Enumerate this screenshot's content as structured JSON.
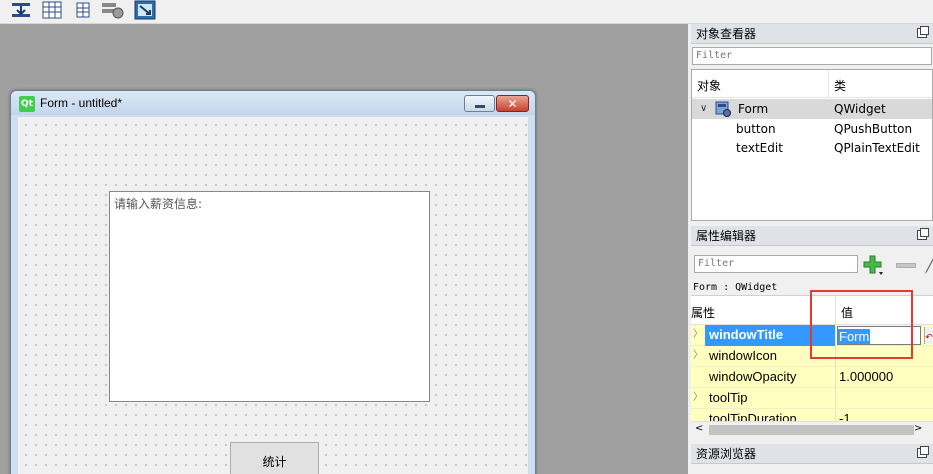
{
  "toolbar": {
    "buttons": [
      {
        "name": "layout-form-icon"
      },
      {
        "name": "layout-grid-icon"
      },
      {
        "name": "layout-grid-small-icon"
      },
      {
        "name": "break-layout-icon"
      },
      {
        "name": "adjust-size-icon"
      }
    ]
  },
  "form_window": {
    "title": "Form - untitled*",
    "logo_text": "Qt",
    "close_glyph": "✕",
    "text_edit": {
      "text": "请输入薪资信息:"
    },
    "push_button": {
      "label": "统计"
    }
  },
  "object_inspector": {
    "title": "对象查看器",
    "filter_placeholder": "Filter",
    "columns": {
      "object": "对象",
      "class": "类"
    },
    "rows": [
      {
        "name": "Form",
        "class": "QWidget",
        "selected": true
      },
      {
        "name": "button",
        "class": "QPushButton",
        "selected": false
      },
      {
        "name": "textEdit",
        "class": "QPlainTextEdit",
        "selected": false
      }
    ]
  },
  "property_editor": {
    "title": "属性编辑器",
    "filter_placeholder": "Filter",
    "class_line": "Form : QWidget",
    "columns": {
      "property": "属性",
      "value": "值"
    },
    "rows": [
      {
        "name": "windowTitle",
        "value": "Form",
        "selected": true
      },
      {
        "name": "windowIcon",
        "value": ""
      },
      {
        "name": "windowOpacity",
        "value": "1.000000"
      },
      {
        "name": "toolTip",
        "value": ""
      },
      {
        "name": "toolTipDuration",
        "value": "-1"
      }
    ]
  },
  "resource_browser": {
    "title": "资源浏览器"
  },
  "colors": {
    "selection": "#3399ff",
    "property_row_bg": "#ffffc0",
    "highlight_box": "#e53935",
    "workspace_bg": "#a0a0a0"
  }
}
